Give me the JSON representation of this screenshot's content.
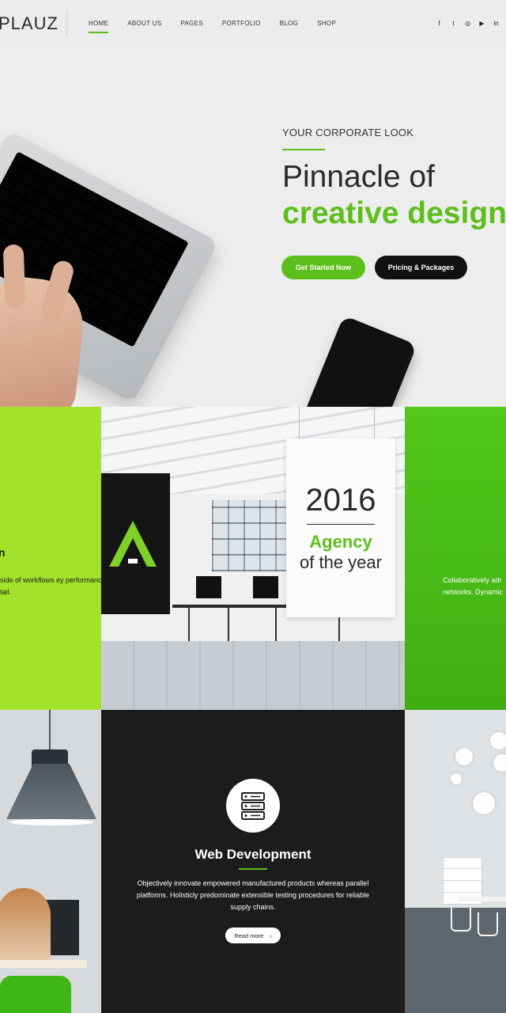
{
  "nav": {
    "logo": "PLAUZ",
    "items": [
      {
        "label": "HOME",
        "active": true
      },
      {
        "label": "ABOUT US",
        "active": false
      },
      {
        "label": "PAGES",
        "active": false
      },
      {
        "label": "PORTFOLIO",
        "active": false
      },
      {
        "label": "BLOG",
        "active": false
      },
      {
        "label": "SHOP",
        "active": false
      }
    ],
    "social": [
      {
        "icon": "facebook-icon",
        "glyph": "f"
      },
      {
        "icon": "twitter-icon",
        "glyph": "t"
      },
      {
        "icon": "instagram-icon",
        "glyph": "◎"
      },
      {
        "icon": "youtube-icon",
        "glyph": "▶"
      },
      {
        "icon": "linkedin-icon",
        "glyph": "in"
      }
    ]
  },
  "hero": {
    "eyebrow": "YOUR CORPORATE LOOK",
    "title_line1": "Pinnacle of",
    "title_line2": "creative design",
    "primary_button": "Get Started Now",
    "secondary_button": "Pricing & Packages"
  },
  "tiles": {
    "lime": {
      "title": "n",
      "text": "side of workflows ey performance ing tail."
    },
    "poster": {
      "year": "2016",
      "agency": "Agency",
      "tagline": "of the year"
    },
    "green": {
      "text_line1": "Collaboratively adr",
      "text_line2": "networks. Dynamic"
    },
    "service": {
      "icon": "server-icon",
      "title": "Web Development",
      "text": "Objectively innovate empowered manufactured products whereas parallel platforms. Holisticly predominate extensible testing procedures for reliable supply chains.",
      "button": "Read more",
      "button_icon": "chevron-right-icon"
    }
  },
  "colors": {
    "accent_green": "#5cbf1b",
    "lime": "#a3e22a",
    "dark": "#1c1c1c"
  }
}
